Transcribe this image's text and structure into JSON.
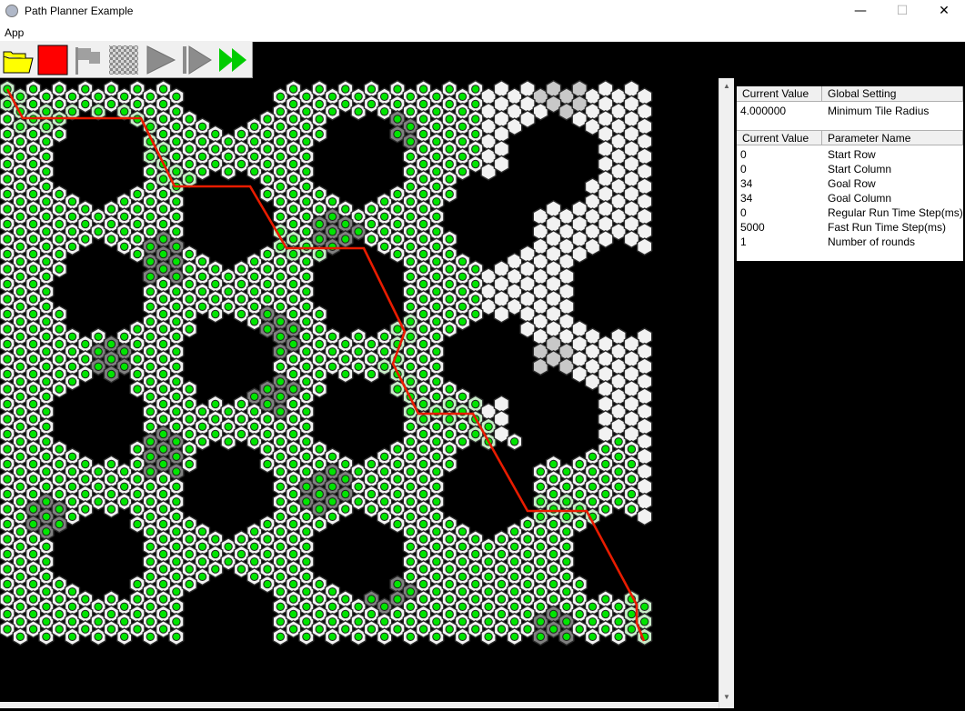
{
  "window": {
    "title": "Path Planner Example",
    "minimize_glyph": "—",
    "maximize_glyph": "☐",
    "close_glyph": "✕"
  },
  "menu": {
    "items": [
      "App"
    ]
  },
  "toolbar": {
    "buttons": [
      "open-folder",
      "stop",
      "set-goal-flag",
      "toggle-grid",
      "run",
      "step",
      "fast-run"
    ],
    "colors": {
      "folder": "#ffff00",
      "stop": "#ff0000",
      "play_gray": "#8c8c8c",
      "fast_green": "#00cc00"
    }
  },
  "map": {
    "path_color": "#e81c00",
    "node_color": "#00e400",
    "tile_color": "#f2f2f2"
  },
  "global_settings": {
    "header_value": "Current Value",
    "header_name": "Global Setting",
    "rows": [
      {
        "value": "4.000000",
        "name": "Minimum Tile Radius"
      }
    ]
  },
  "parameters": {
    "header_value": "Current Value",
    "header_name": "Parameter Name",
    "rows": [
      {
        "value": "0",
        "name": "Start Row"
      },
      {
        "value": "0",
        "name": "Start Column"
      },
      {
        "value": "34",
        "name": "Goal Row"
      },
      {
        "value": "34",
        "name": "Goal Column"
      },
      {
        "value": "0",
        "name": "Regular Run Time Step(ms)"
      },
      {
        "value": "5000",
        "name": "Fast Run Time Step(ms)"
      },
      {
        "value": "1",
        "name": "Number of rounds"
      }
    ]
  }
}
